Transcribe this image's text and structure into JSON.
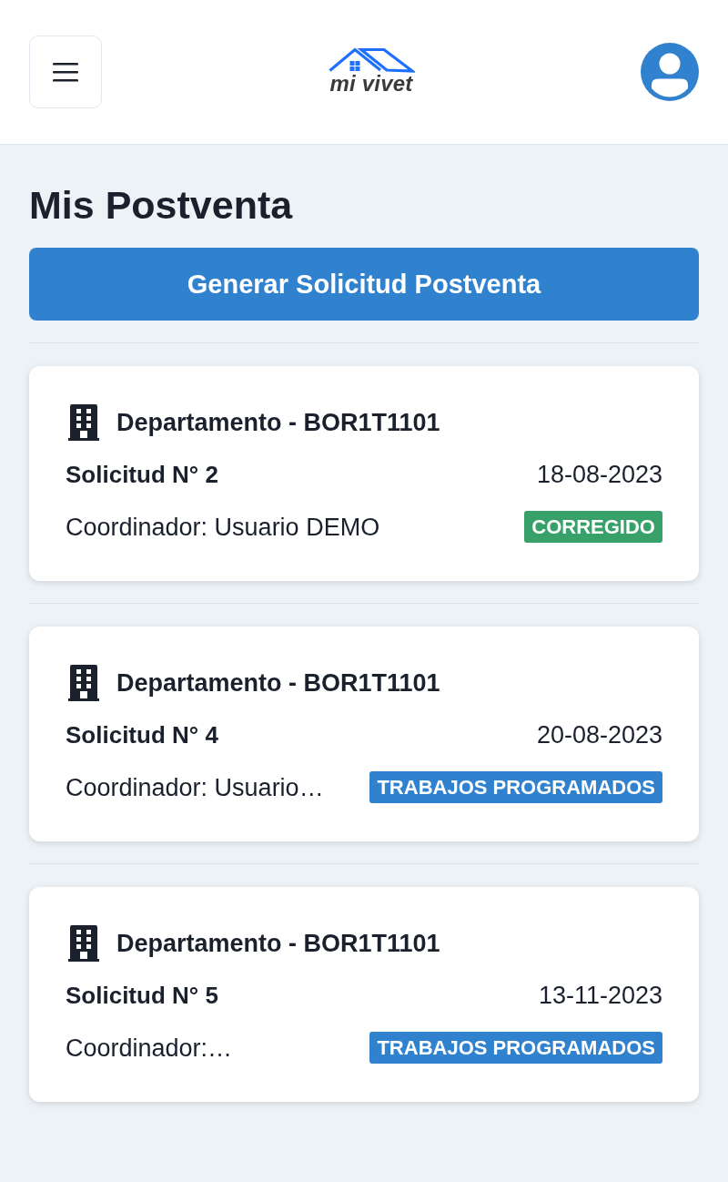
{
  "header": {
    "logo_text": "mi vivet"
  },
  "page": {
    "title": "Mis Postventa",
    "action_button": "Generar Solicitud Postventa"
  },
  "requests": [
    {
      "property": "Departamento - BOR1T1101",
      "number": "Solicitud N° 2",
      "date": "18-08-2023",
      "coordinator": "Coordinador: Usuario DEMO",
      "status": {
        "label": "CORREGIDO",
        "color": "#38a169"
      }
    },
    {
      "property": "Departamento - BOR1T1101",
      "number": "Solicitud N° 4",
      "date": "20-08-2023",
      "coordinator": "Coordinador: Usuario…",
      "status": {
        "label": "TRABAJOS PROGRAMADOS",
        "color": "#3182ce"
      }
    },
    {
      "property": "Departamento - BOR1T1101",
      "number": "Solicitud N° 5",
      "date": "13-11-2023",
      "coordinator": "Coordinador:…",
      "status": {
        "label": "TRABAJOS PROGRAMADOS",
        "color": "#3182ce"
      }
    }
  ]
}
